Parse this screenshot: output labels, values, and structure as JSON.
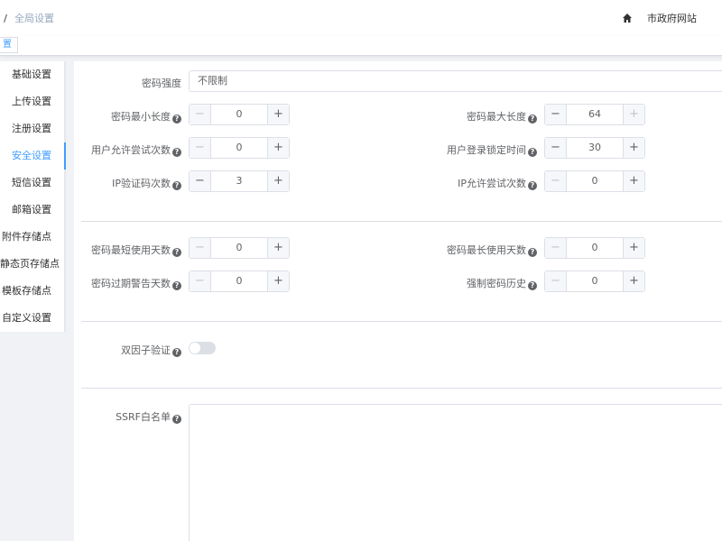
{
  "header": {
    "breadcrumb_sep": "/",
    "breadcrumb_current": "全局设置",
    "site_link": "市政府网站"
  },
  "tagsbar": {
    "tag_label": "置"
  },
  "sidebar": {
    "items": [
      {
        "label": "基础设置"
      },
      {
        "label": "上传设置"
      },
      {
        "label": "注册设置"
      },
      {
        "label": "安全设置"
      },
      {
        "label": "短信设置"
      },
      {
        "label": "邮箱设置"
      },
      {
        "label": "附件存储点"
      },
      {
        "label": "静态页存储点"
      },
      {
        "label": "模板存储点"
      },
      {
        "label": "自定义设置"
      }
    ],
    "active_index": 3
  },
  "form": {
    "password_strength": {
      "label": "密码强度",
      "value": "不限制"
    },
    "min_length": {
      "label": "密码最小长度",
      "value": "0"
    },
    "max_length": {
      "label": "密码最大长度",
      "value": "64"
    },
    "allowed_attempts": {
      "label": "用户允许尝试次数",
      "value": "0"
    },
    "lock_time": {
      "label": "用户登录锁定时间",
      "value": "30"
    },
    "ip_captcha_count": {
      "label": "IP验证码次数",
      "value": "3"
    },
    "ip_allowed_attempts": {
      "label": "IP允许尝试次数",
      "value": "0"
    },
    "min_use_days": {
      "label": "密码最短使用天数",
      "value": "0"
    },
    "max_use_days": {
      "label": "密码最长使用天数",
      "value": "0"
    },
    "expire_warn_days": {
      "label": "密码过期警告天数",
      "value": "0"
    },
    "forced_history": {
      "label": "强制密码历史",
      "value": "0"
    },
    "two_factor": {
      "label": "双因子验证",
      "enabled": false
    },
    "ssrf_whitelist": {
      "label": "SSRF白名单",
      "value": ""
    }
  },
  "symbols": {
    "minus": "−",
    "plus": "+",
    "help": "?"
  },
  "colors": {
    "accent": "#409eff",
    "border": "#dcdfe6",
    "text": "#606266"
  },
  "icons": {
    "home": "home-icon",
    "help": "question-circle-icon"
  }
}
